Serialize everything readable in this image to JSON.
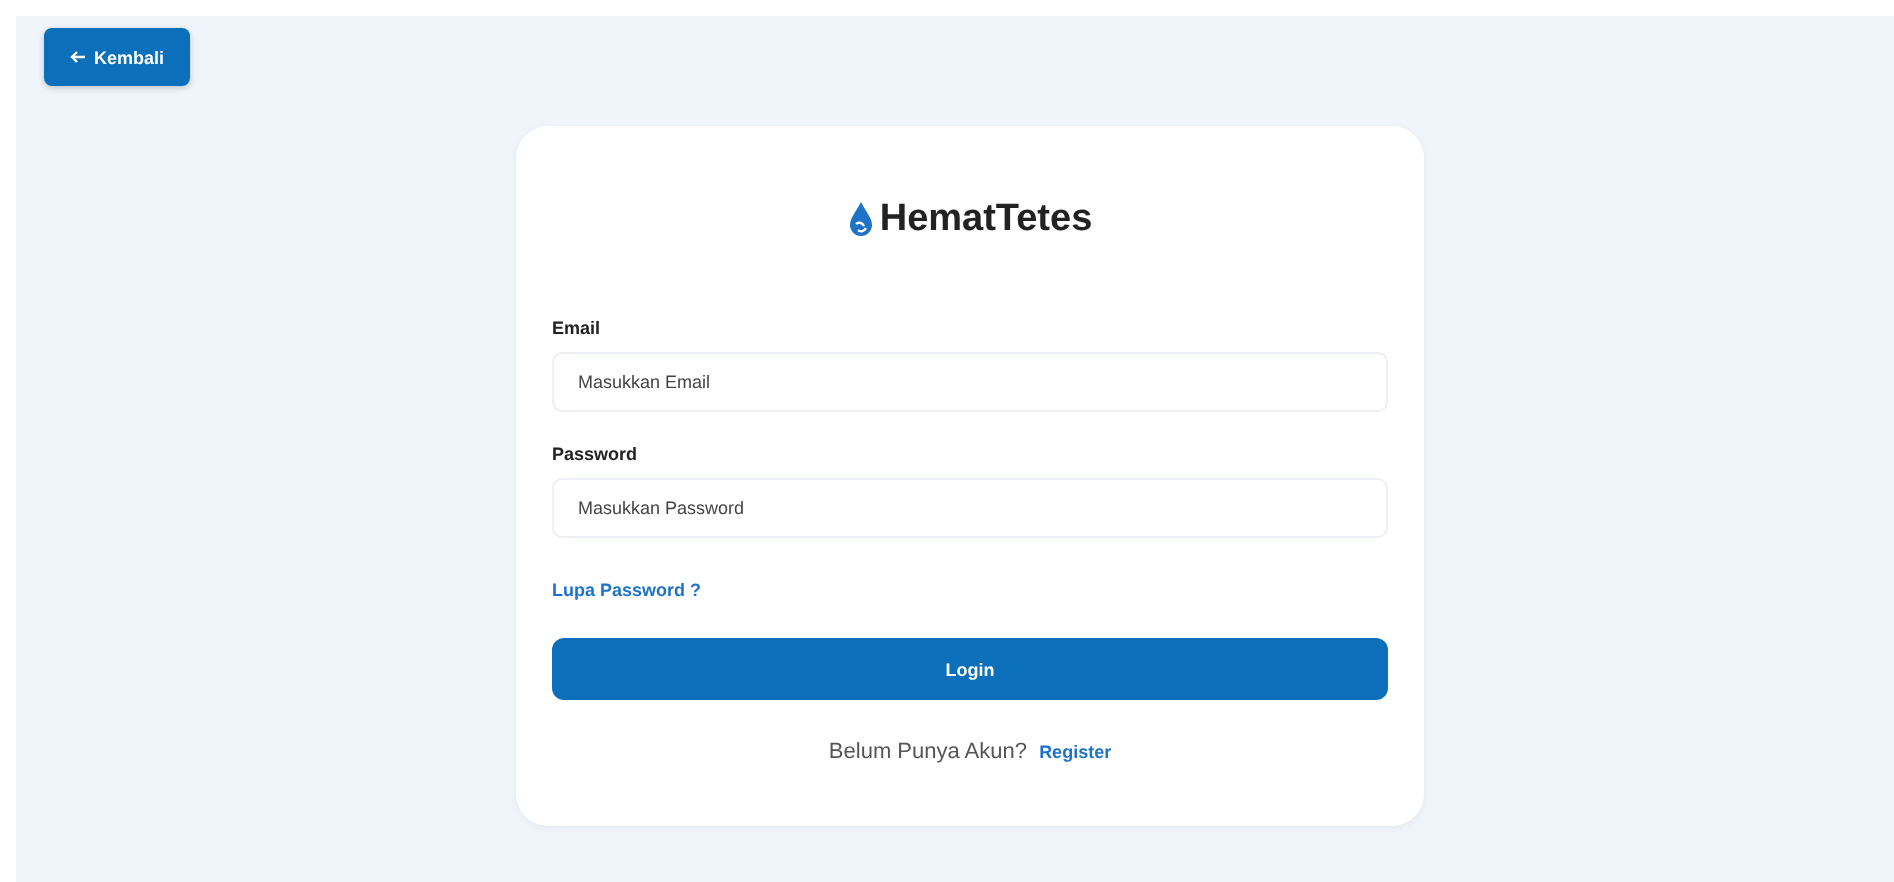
{
  "back_button": {
    "label": "Kembali"
  },
  "logo": {
    "text": "HematTetes"
  },
  "fields": [
    {
      "label": "Email",
      "placeholder": "Masukkan Email"
    },
    {
      "label": "Password",
      "placeholder": "Masukkan Password"
    }
  ],
  "forgot_link": "Lupa Password ?",
  "login_button": "Login",
  "footer": {
    "text": "Belum Punya Akun?",
    "link": "Register"
  }
}
